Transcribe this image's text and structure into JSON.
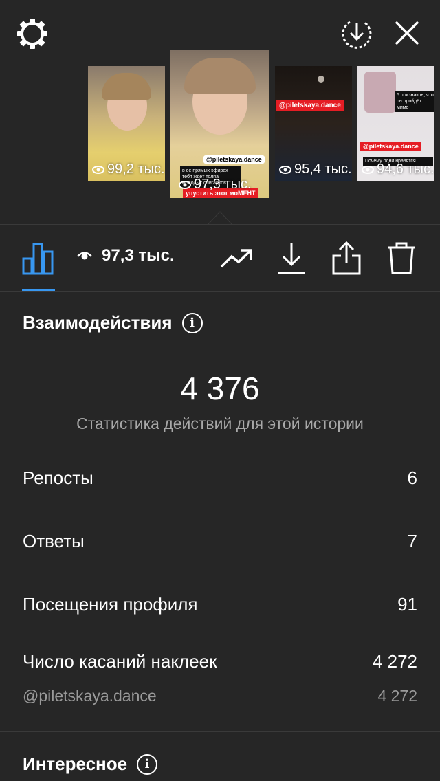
{
  "top_bar": {
    "settings_icon": "gear-icon",
    "download_all_icon": "download-circle-icon",
    "close_icon": "close-icon"
  },
  "thumbnails": [
    {
      "views": "99,2 тыс."
    },
    {
      "views": "97,3 тыс.",
      "stickers": [
        "@piletskaya.dance",
        "в ее прямых эфирах тебя ждёт толпа молодых олигархов",
        "упустить этот моМЕНТ"
      ]
    },
    {
      "views": "95,4 тыс.",
      "stickers": [
        "@piletskaya.dance"
      ]
    },
    {
      "views": "94,6 тыс.",
      "stickers": [
        "5 признаков, что он пройдёт мимо",
        "@piletskaya.dance",
        "Почему одни нравятся"
      ]
    }
  ],
  "toolbar": {
    "stats_icon": "bar-chart-icon",
    "views_icon": "eye-icon",
    "views_value": "97,3 тыс.",
    "promote_icon": "trending-up-icon",
    "save_icon": "download-icon",
    "share_icon": "share-icon",
    "delete_icon": "trash-icon"
  },
  "interactions": {
    "title": "Взаимодействия",
    "total": "4 376",
    "subtitle": "Статистика действий для этой истории",
    "rows": [
      {
        "label": "Репосты",
        "value": "6"
      },
      {
        "label": "Ответы",
        "value": "7"
      },
      {
        "label": "Посещения профиля",
        "value": "91"
      },
      {
        "label": "Число касаний наклеек",
        "value": "4 272"
      }
    ],
    "sticker_detail": {
      "label": "@piletskaya.dance",
      "value": "4 272"
    }
  },
  "discovery": {
    "title": "Интересное"
  },
  "colors": {
    "background": "#262626",
    "accent": "#3897f0",
    "sticker_red": "#e51d24",
    "muted_text": "#a8a8a8"
  }
}
